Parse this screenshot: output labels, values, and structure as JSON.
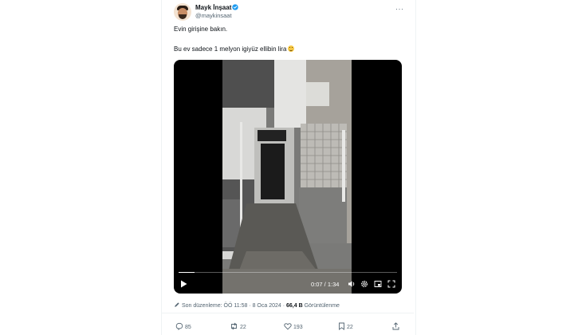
{
  "author": {
    "name": "Mayk İnşaat",
    "handle": "@maykinsaat"
  },
  "tweet": {
    "line1": "Evin girişine bakın.",
    "line2": "Bu ev sadece 1 melyon igiyüz ellibin lira"
  },
  "video": {
    "time": "0:07 / 1:34",
    "progress": 0.0745
  },
  "meta": {
    "edited": "Son düzenleme: ÖÖ 11:58 · 8 Oca 2024 · ",
    "views_count": "66,4 B",
    "views_label": " Görüntülenme"
  },
  "actions": {
    "replies": "85",
    "reposts": "22",
    "likes": "193",
    "bookmarks": "22"
  },
  "colors": {
    "verified": "#1d9bf0",
    "secondary_text": "#536471",
    "primary_text": "#0f1419"
  }
}
